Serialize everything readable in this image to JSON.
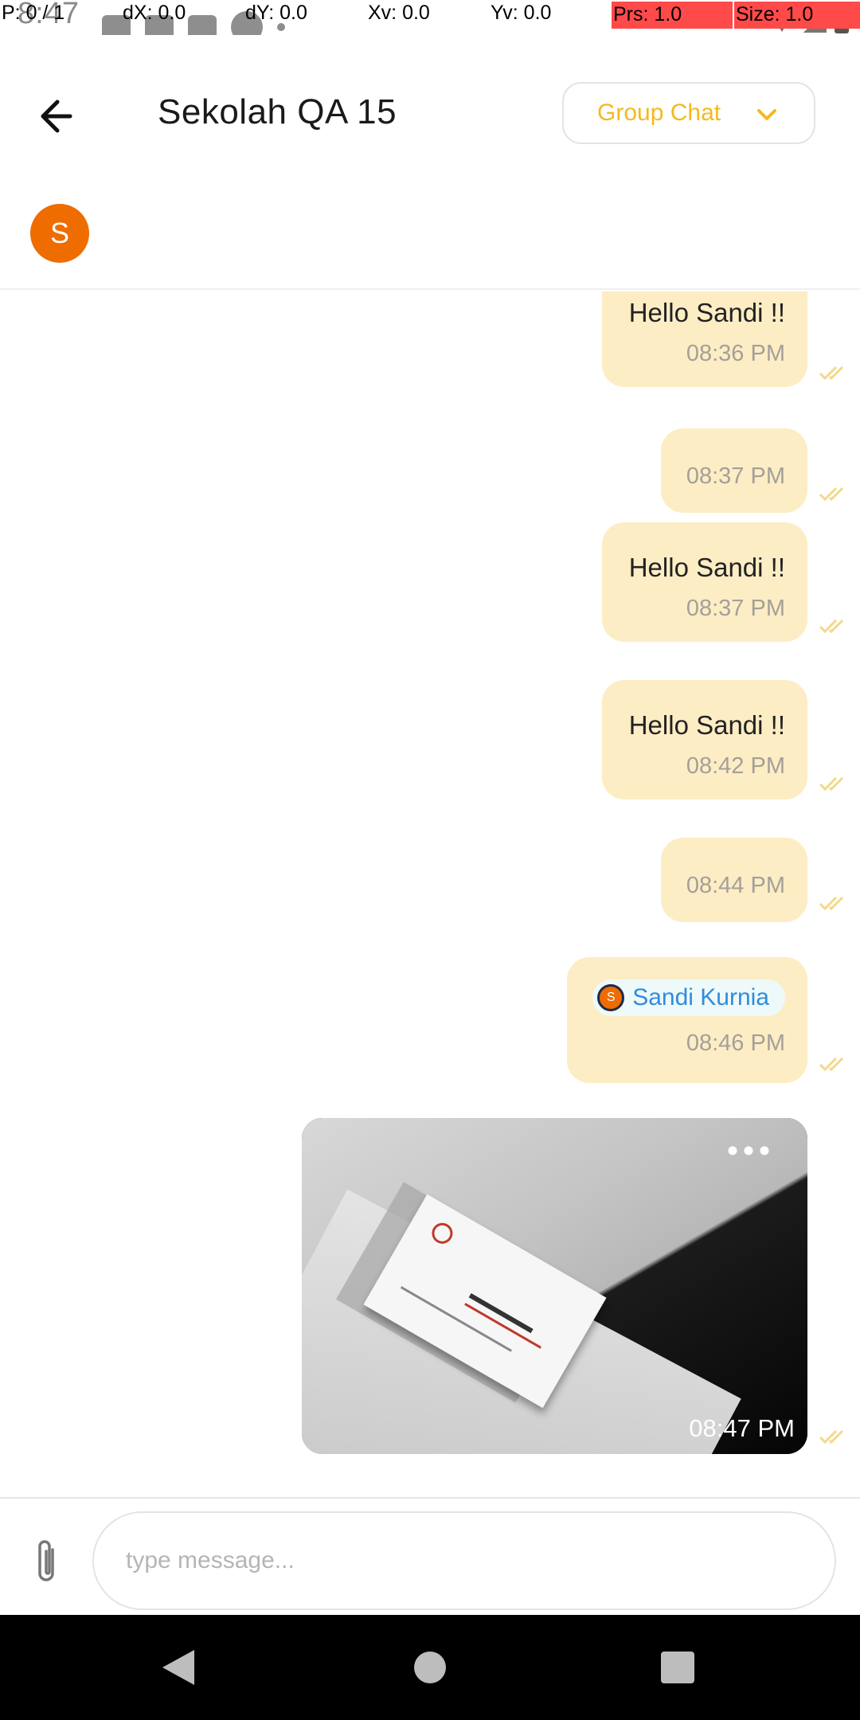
{
  "status": {
    "time": "8:47"
  },
  "debug": {
    "p": "P: 0 / 1",
    "dx": "dX: 0.0",
    "dy": "dY: 0.0",
    "xv": "Xv: 0.0",
    "yv": "Yv: 0.0",
    "prs": "Prs: 1.0",
    "size": "Size: 1.0"
  },
  "header": {
    "title": "Sekolah QA 15",
    "chat_type": "Group Chat",
    "avatar_initial": "S"
  },
  "messages": [
    {
      "text": "Hello Sandi !!",
      "time": "08:36 PM",
      "status": "read"
    },
    {
      "text": "",
      "time": "08:37 PM",
      "status": "read"
    },
    {
      "text": "Hello Sandi !!",
      "time": "08:37 PM",
      "status": "read"
    },
    {
      "text": "Hello Sandi !!",
      "time": "08:42 PM",
      "status": "read"
    },
    {
      "text": "",
      "time": "08:44 PM",
      "status": "read"
    },
    {
      "mention": {
        "initial": "S",
        "name": "Sandi Kurnia"
      },
      "time": "08:46 PM",
      "status": "read"
    },
    {
      "image": true,
      "time": "08:47 PM",
      "status": "read"
    }
  ],
  "composer": {
    "placeholder": "type message..."
  },
  "colors": {
    "bubble": "#fdedc4",
    "accent": "#f5b91d",
    "avatar": "#ef6c00",
    "mention_text": "#2f8ddc",
    "check": "#f3d98a"
  },
  "icons": {
    "back": "arrow-left-icon",
    "dropdown": "chevron-down-icon",
    "attach": "paperclip-icon",
    "more": "more-horizontal-icon",
    "read": "double-check-icon"
  }
}
